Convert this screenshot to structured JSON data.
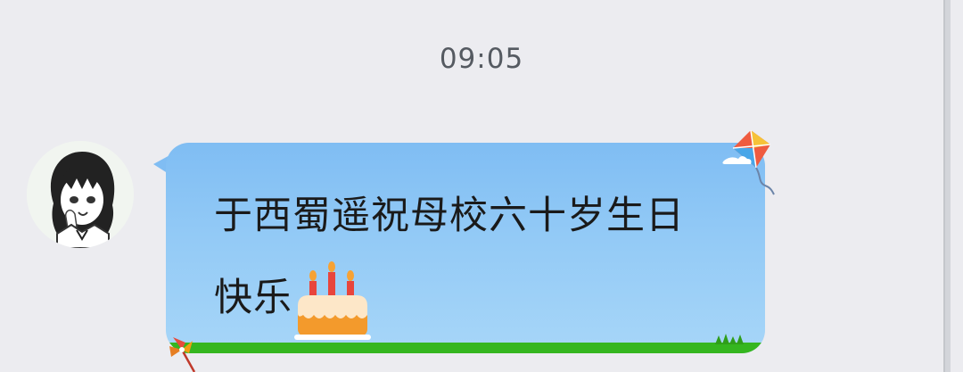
{
  "chat": {
    "timestamp": "09:05",
    "messages": [
      {
        "sender": "contact",
        "line1": "于西蜀遥祝母校六十岁生日",
        "line2": "快乐",
        "emoji": "birthday-cake-icon"
      }
    ]
  },
  "colors": {
    "background": "#ececf0",
    "bubble_top": "#7fbdf3",
    "bubble_bottom": "#a7d6f8",
    "grass": "#35b61f",
    "timestamp_text": "#555a61"
  }
}
